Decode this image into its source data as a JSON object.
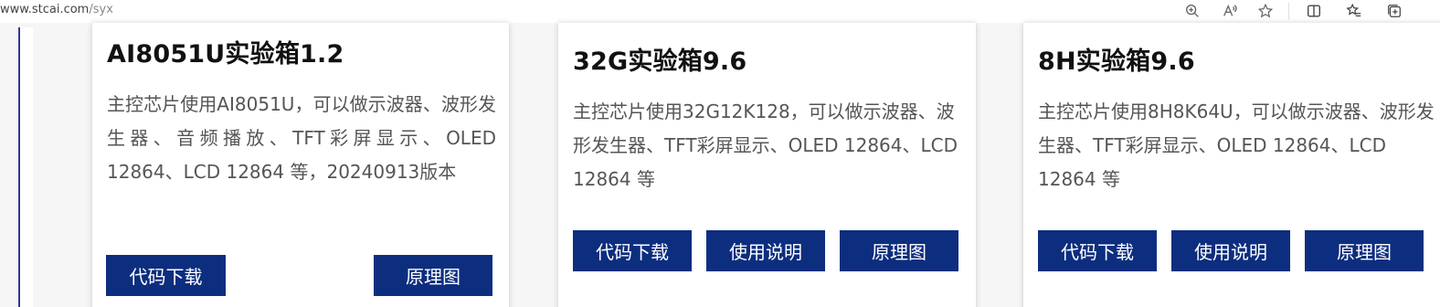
{
  "browser": {
    "url_host": "www.stcai.com",
    "url_path": "/syx",
    "toolbar_icons": [
      "zoom-icon",
      "read-aloud-icon",
      "favorite-star-icon",
      "split-screen-icon",
      "favorites-icon",
      "collections-icon"
    ]
  },
  "colors": {
    "button_bg": "#0d2e7f",
    "button_text": "#ffffff",
    "left_accent": "#2a3c8c"
  },
  "cards": [
    {
      "title": "AI8051U实验箱1.2",
      "description": "主控芯片使用AI8051U，可以做示波器、波形发生器、音频播放、TFT彩屏显示、OLED 12864、LCD 12864 等，20240913版本",
      "buttons": [
        "代码下载",
        "原理图"
      ]
    },
    {
      "title": "32G实验箱9.6",
      "description": "主控芯片使用32G12K128，可以做示波器、波形发生器、TFT彩屏显示、OLED 12864、LCD 12864 等",
      "buttons": [
        "代码下载",
        "使用说明",
        "原理图"
      ]
    },
    {
      "title": "8H实验箱9.6",
      "description": "主控芯片使用8H8K64U，可以做示波器、波形发生器、TFT彩屏显示、OLED 12864、LCD 12864 等",
      "buttons": [
        "代码下载",
        "使用说明",
        "原理图"
      ]
    }
  ]
}
